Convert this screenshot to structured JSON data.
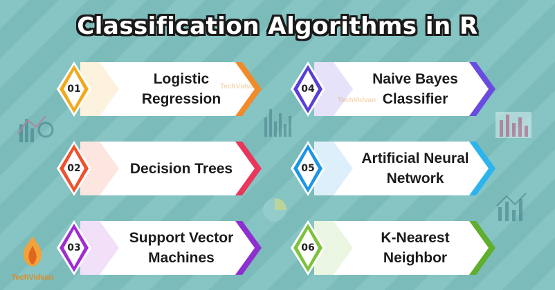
{
  "title": "Classification Algorithms in R",
  "logo_text": "TechVidvan",
  "cards": [
    {
      "number": "01",
      "label": "Logistic\nRegression",
      "color": "#f3a81c",
      "accent": "#f08a2a"
    },
    {
      "number": "02",
      "label": "Decision Trees",
      "color": "#f0502c",
      "accent": "#e8375a"
    },
    {
      "number": "03",
      "label": "Support Vector\nMachines",
      "color": "#a12ccf",
      "accent": "#8e2fd0"
    },
    {
      "number": "04",
      "label": "Naive Bayes\nClassifier",
      "color": "#5a3ed6",
      "accent": "#6a4be0"
    },
    {
      "number": "05",
      "label": "Artificial Neural\nNetwork",
      "color": "#1d95e6",
      "accent": "#2db4ef"
    },
    {
      "number": "06",
      "label": "K-Nearest\nNeighbor",
      "color": "#7cc23a",
      "accent": "#5fae2e"
    }
  ]
}
